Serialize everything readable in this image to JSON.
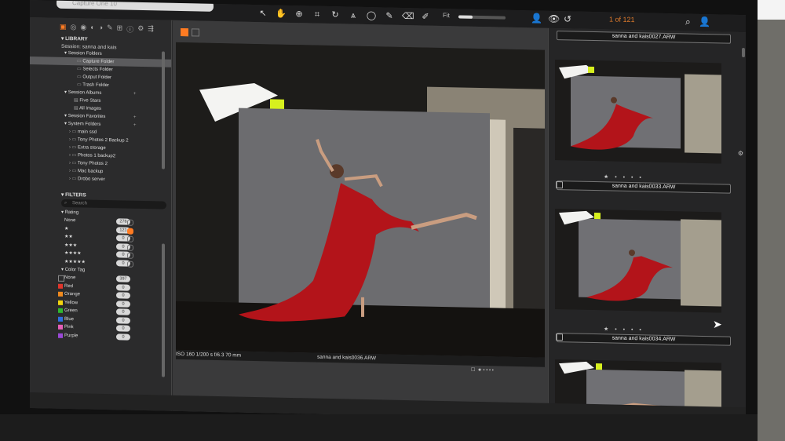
{
  "window": {
    "title_field": "Capture One 10"
  },
  "toolbar": {
    "tools": [
      {
        "icon": "select-arrow-icon",
        "glyph": "↖",
        "active": false
      },
      {
        "icon": "pan-hand-icon",
        "glyph": "✋",
        "active": true
      },
      {
        "icon": "loupe-icon",
        "glyph": "⊕",
        "active": false
      },
      {
        "icon": "crop-icon",
        "glyph": "⌗",
        "active": false
      },
      {
        "icon": "rotate-icon",
        "glyph": "↻",
        "active": false
      },
      {
        "icon": "keystone-icon",
        "glyph": "⩓",
        "active": false
      },
      {
        "icon": "spot-icon",
        "glyph": "◯",
        "active": false
      },
      {
        "icon": "brush-icon",
        "glyph": "✎",
        "active": false
      },
      {
        "icon": "eraser-icon",
        "glyph": "⌫",
        "active": false
      },
      {
        "icon": "picker-icon",
        "glyph": "✐",
        "active": false
      }
    ],
    "fit_label": "Fit",
    "zoom_level": 0.3,
    "counter": "1 of 121"
  },
  "library": {
    "header": "LIBRARY",
    "session": "Session: sanna and kais",
    "session_folders_label": "Session Folders",
    "session_folders": [
      "Capture Folder",
      "Selects Folder",
      "Output Folder",
      "Trash Folder"
    ],
    "session_albums_label": "Session Albums",
    "session_albums": [
      "Five Stars",
      "All Images"
    ],
    "session_favorites_label": "Session Favorites",
    "system_folders_label": "System Folders",
    "system_folders": [
      "main ssd",
      "Tony Photos 2 Backup 2",
      "Extra storage",
      "Photos 1 backup2",
      "Tony Photos 2",
      "Mac backup",
      "Drobo server"
    ]
  },
  "filters": {
    "header": "FILTERS",
    "search_placeholder": "Search",
    "rating_label": "Rating",
    "ratings": [
      {
        "label": "None",
        "count": "276"
      },
      {
        "label": "★",
        "count": "121"
      },
      {
        "label": "★★",
        "count": "0"
      },
      {
        "label": "★★★",
        "count": "0"
      },
      {
        "label": "★★★★",
        "count": "0"
      },
      {
        "label": "★★★★★",
        "count": "0"
      }
    ],
    "color_tag_label": "Color Tag",
    "color_tags": [
      {
        "label": "None",
        "count": "397",
        "color": "#2b2b2c"
      },
      {
        "label": "Red",
        "count": "0",
        "color": "#e0362c"
      },
      {
        "label": "Orange",
        "count": "0",
        "color": "#f08a1e"
      },
      {
        "label": "Yellow",
        "count": "0",
        "color": "#f2d40f"
      },
      {
        "label": "Green",
        "count": "0",
        "color": "#2fb82f"
      },
      {
        "label": "Blue",
        "count": "0",
        "color": "#2f6ee0"
      },
      {
        "label": "Pink",
        "count": "0",
        "color": "#e65fb8"
      },
      {
        "label": "Purple",
        "count": "0",
        "color": "#9a49d6"
      }
    ]
  },
  "viewer": {
    "exif": "ISO 160     1/200 s     f/6.3     70 mm",
    "filename": "sanna and kais0036.ARW",
    "rating": "★ • • • •"
  },
  "browser": {
    "items": [
      {
        "name": "sanna and kais0027.ARW",
        "rating": "★ • • • •"
      },
      {
        "name": "sanna and kais0033.ARW",
        "rating": "★ • • • •"
      },
      {
        "name": "sanna and kais0034.ARW",
        "rating": "★ • • • •"
      }
    ]
  },
  "colors": {
    "accent": "#ff7b22",
    "dress": "#b3141a",
    "backdrop": "#6d6d70"
  }
}
